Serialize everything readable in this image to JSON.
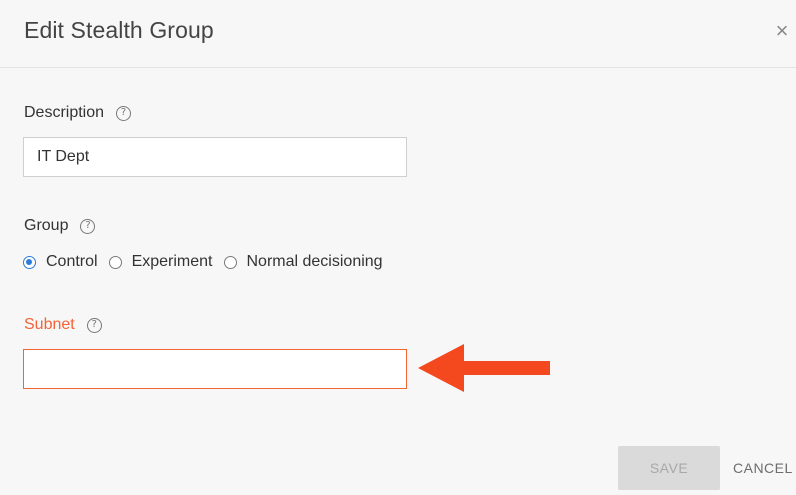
{
  "dialog": {
    "title": "Edit Stealth Group",
    "close_glyph": "×"
  },
  "description": {
    "label": "Description",
    "help_glyph": "?",
    "value": "IT Dept"
  },
  "group": {
    "label": "Group",
    "help_glyph": "?",
    "options": [
      {
        "label": "Control",
        "checked": true
      },
      {
        "label": "Experiment",
        "checked": false
      },
      {
        "label": "Normal decisioning",
        "checked": false
      }
    ]
  },
  "subnet": {
    "label": "Subnet",
    "help_glyph": "?",
    "value": "",
    "state": "error"
  },
  "actions": {
    "save_label": "SAVE",
    "cancel_label": "CANCEL",
    "save_disabled": true
  },
  "annotation": {
    "icon": "left-arrow-icon",
    "color": "#f4481e"
  },
  "colors": {
    "error": "#f26436",
    "radio_accent": "#2e7ad8",
    "background": "#f7f7f7"
  }
}
